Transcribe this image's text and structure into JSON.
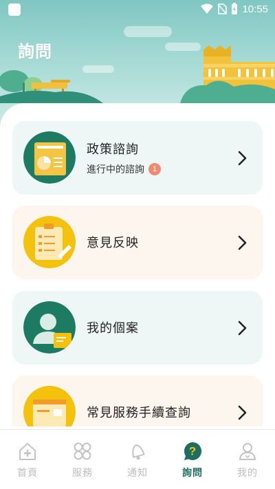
{
  "status_bar": {
    "time": "10:55"
  },
  "page_title": "詢問",
  "cards": [
    {
      "title": "政策諮詢",
      "subtitle": "進行中的諮詢",
      "badge": "1",
      "theme": "green"
    },
    {
      "title": "意見反映",
      "theme": "peach"
    },
    {
      "title": "我的個案",
      "theme": "green"
    },
    {
      "title": "常見服務手續查詢",
      "theme": "peach"
    }
  ],
  "bottom_nav": [
    {
      "label": "首頁",
      "icon": "home-icon"
    },
    {
      "label": "服務",
      "icon": "services-grid-icon"
    },
    {
      "label": "通知",
      "icon": "bell-icon"
    },
    {
      "label": "詢問",
      "icon": "question-bubble-icon",
      "active": true
    },
    {
      "label": "我的",
      "icon": "profile-icon"
    }
  ],
  "colors": {
    "primary": "#1d6e5f",
    "accent": "#f4c20d",
    "badge": "#ef8b70",
    "card_green": "#eef7f5",
    "card_peach": "#fdf6ee"
  }
}
